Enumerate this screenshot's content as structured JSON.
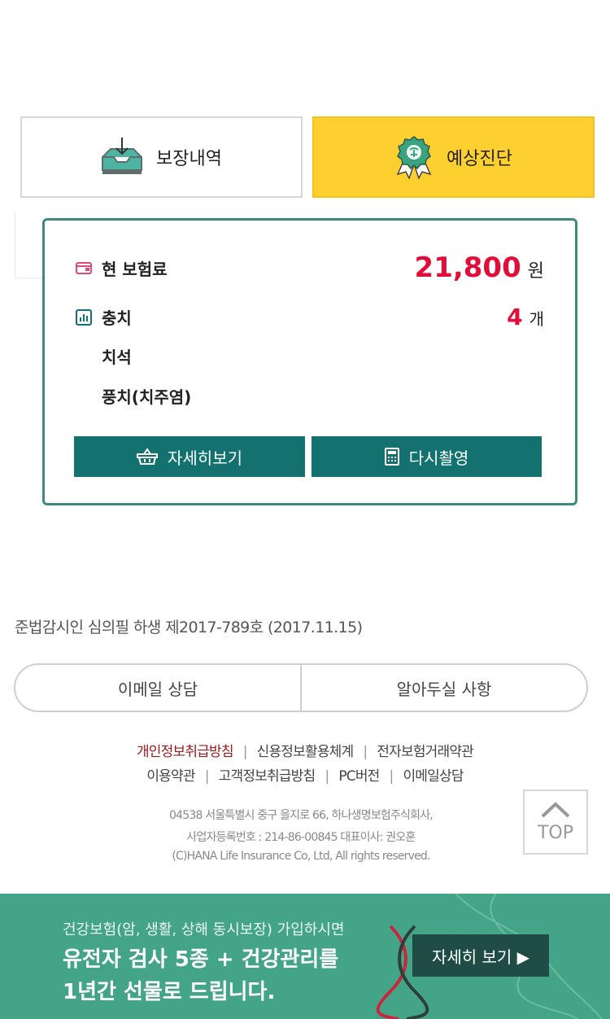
{
  "tabs": {
    "coverage": {
      "label": "보장내역",
      "icon": "inbox-download-icon"
    },
    "diagnosis": {
      "label": "예상진단",
      "icon": "medal-badge-icon"
    }
  },
  "card": {
    "premium": {
      "label": "현 보험료",
      "value": "21,800",
      "unit": "원",
      "icon": "wallet-icon"
    },
    "cavity": {
      "label": "충치",
      "value": "4",
      "unit": "개",
      "icon": "bar-chart-icon"
    },
    "sub_items": [
      "치석",
      "풍치(치주염)"
    ],
    "buttons": {
      "detail": {
        "label": "자세히보기",
        "icon": "basket-icon"
      },
      "retake": {
        "label": "다시촬영",
        "icon": "calculator-icon"
      }
    }
  },
  "notice": "준법감시인 심의필 하생 제2017-789호 (2017.11.15)",
  "contact": {
    "email": "이메일 상담",
    "notes": "알아두실 사항"
  },
  "footer_links": {
    "row1": [
      "개인정보취급방침",
      "신용정보활용체계",
      "전자보험거래약관"
    ],
    "row2": [
      "이용약관",
      "고객정보취급방침",
      "PC버전",
      "이메일상담"
    ]
  },
  "address": {
    "line1": "04538 서울특별시 중구 을지로 66, 하나생명보험주식회사,",
    "line2": "사업자등록번호 : 214-86-00845 대표이사: 권오훈",
    "line3": "(C)HANA Life Insurance Co, Ltd, All rights reserved."
  },
  "top_button": "TOP",
  "banner": {
    "line1": "건강보험(암, 생활, 상해 동시보장) 가입하시면",
    "line2": "유전자 검사 5종 + 건강관리를",
    "line3": "1년간 선물로 드립니다.",
    "cta": "자세히 보기 ▶",
    "bg_color": "#44a487"
  },
  "colors": {
    "accent_teal": "#137170",
    "highlight_red": "#e10e3a",
    "tab_yellow": "#fdd02f"
  }
}
